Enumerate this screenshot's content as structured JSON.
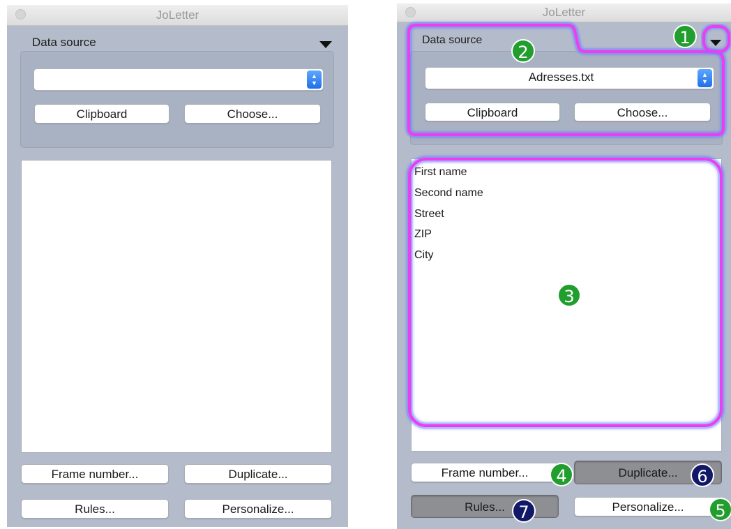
{
  "left_panel": {
    "window_title": "JoLetter",
    "data_source_label": "Data source",
    "popup_value": "",
    "clipboard_label": "Clipboard",
    "choose_label": "Choose...",
    "frame_number_label": "Frame number...",
    "duplicate_label": "Duplicate...",
    "rules_label": "Rules...",
    "personalize_label": "Personalize..."
  },
  "right_panel": {
    "window_title": "JoLetter",
    "data_source_label": "Data source",
    "popup_value": "Adresses.txt",
    "clipboard_label": "Clipboard",
    "choose_label": "Choose...",
    "fields": [
      "First name",
      "Second name",
      "Street",
      "ZIP",
      "City"
    ],
    "frame_number_label": "Frame number...",
    "duplicate_label": "Duplicate...",
    "rules_label": "Rules...",
    "personalize_label": "Personalize..."
  },
  "callouts": [
    "1",
    "2",
    "3",
    "4",
    "5",
    "6",
    "7"
  ],
  "colors": {
    "highlight": "#ec3df2",
    "callout_green": "#219e2e",
    "callout_navy": "#111868",
    "window_bg": "#b4bccb",
    "pressed_button": "#8d8f93"
  }
}
